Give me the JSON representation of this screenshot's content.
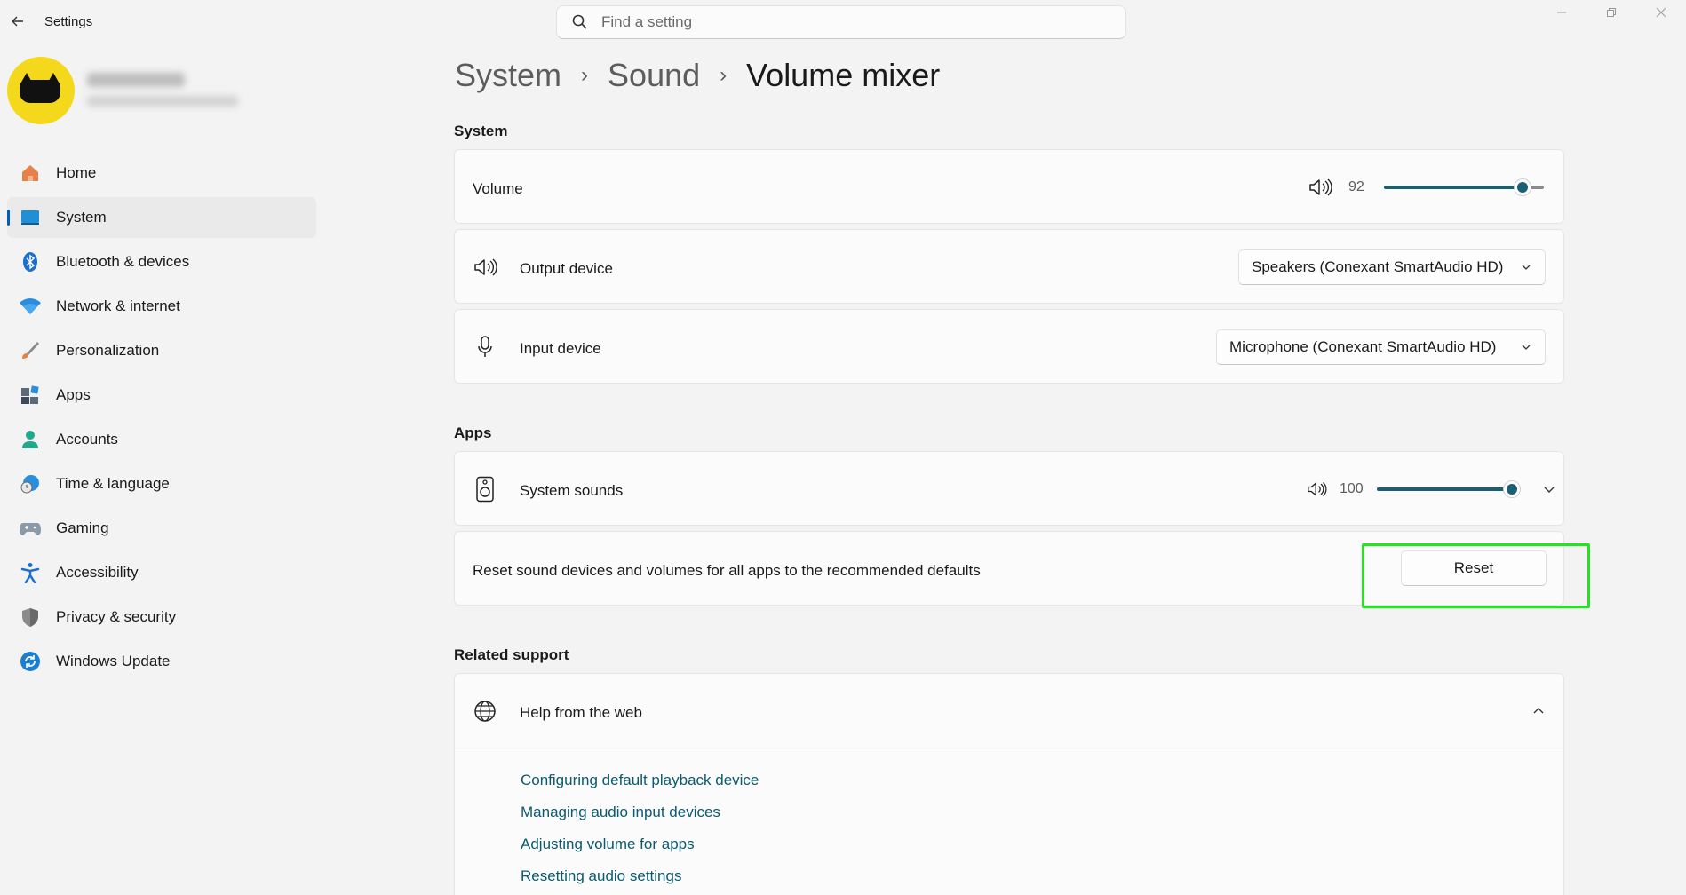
{
  "window": {
    "title": "Settings",
    "search_placeholder": "Find a setting"
  },
  "sidebar": {
    "items": [
      {
        "label": "Home",
        "icon": "home-icon"
      },
      {
        "label": "System",
        "icon": "system-icon",
        "active": true
      },
      {
        "label": "Bluetooth & devices",
        "icon": "bluetooth-icon"
      },
      {
        "label": "Network & internet",
        "icon": "wifi-icon"
      },
      {
        "label": "Personalization",
        "icon": "brush-icon"
      },
      {
        "label": "Apps",
        "icon": "apps-icon"
      },
      {
        "label": "Accounts",
        "icon": "person-icon"
      },
      {
        "label": "Time & language",
        "icon": "globe-clock-icon"
      },
      {
        "label": "Gaming",
        "icon": "controller-icon"
      },
      {
        "label": "Accessibility",
        "icon": "accessibility-icon"
      },
      {
        "label": "Privacy & security",
        "icon": "shield-icon"
      },
      {
        "label": "Windows Update",
        "icon": "update-icon"
      }
    ]
  },
  "breadcrumb": {
    "items": [
      "System",
      "Sound",
      "Volume mixer"
    ],
    "separator": "›"
  },
  "system_section": {
    "title": "System",
    "volume": {
      "label": "Volume",
      "value": "92",
      "level": 0.92
    },
    "output_device": {
      "label": "Output device",
      "selected": "Speakers (Conexant SmartAudio HD)"
    },
    "input_device": {
      "label": "Input device",
      "selected": "Microphone (Conexant SmartAudio HD)"
    }
  },
  "apps_section": {
    "title": "Apps",
    "system_sounds": {
      "label": "System sounds",
      "value": "100",
      "level": 1.0
    },
    "reset": {
      "description": "Reset sound devices and volumes for all apps to the recommended defaults",
      "button_label": "Reset"
    }
  },
  "related_support": {
    "title": "Related support",
    "help_header": "Help from the web",
    "links": [
      "Configuring default playback device",
      "Managing audio input devices",
      "Adjusting volume for apps",
      "Resetting audio settings"
    ]
  },
  "colors": {
    "accent": "#1a5f73",
    "link": "#0b5a70",
    "highlight": "#22e51e",
    "nav_indicator": "#005fb8"
  }
}
